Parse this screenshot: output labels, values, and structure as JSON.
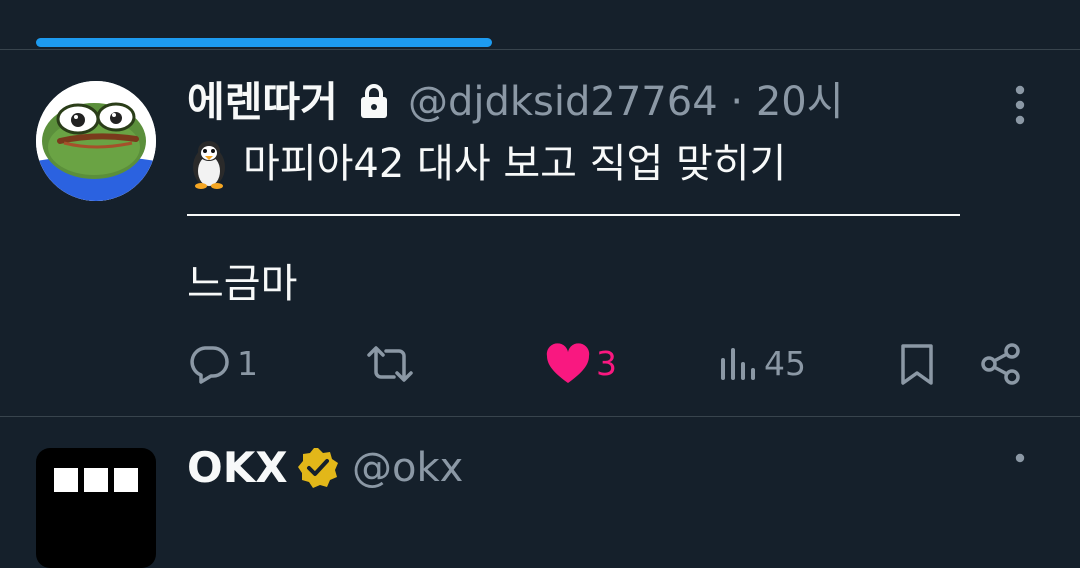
{
  "tabs": {
    "active_indicator_color": "#1d9bf0"
  },
  "tweet": {
    "author": {
      "display_name": "에렌따거",
      "handle": "@djdksid27764",
      "separator": "·",
      "time": "20시",
      "protected_icon": "lock-icon"
    },
    "body": {
      "emoji": "penguin-icon",
      "line1": "마피아42 대사 보고 직업 맞히기",
      "line2": "느금마"
    },
    "actions": {
      "reply_count": "1",
      "retweet_count": "",
      "like_count": "3",
      "views_count": "45"
    },
    "like_color": "#f91880"
  },
  "next_tweet": {
    "author": {
      "display_name": "OKX",
      "handle": "@okx",
      "verified_icon": "verified-badge-icon"
    }
  }
}
